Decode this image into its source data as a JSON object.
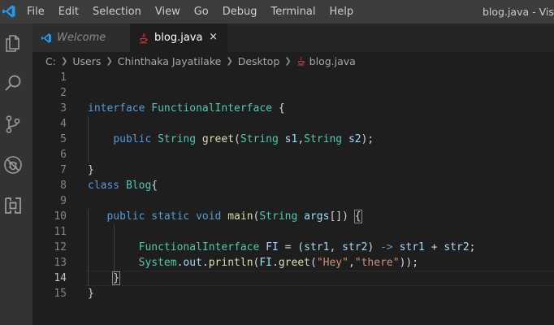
{
  "titlebar": {
    "menu": [
      "File",
      "Edit",
      "Selection",
      "View",
      "Go",
      "Debug",
      "Terminal",
      "Help"
    ],
    "window_title": "blog.java - Visua"
  },
  "activity_bar": [
    "explorer-icon",
    "search-icon",
    "source-control-icon",
    "debug-icon",
    "extensions-icon"
  ],
  "tabs": [
    {
      "label": "Welcome",
      "icon": "vscode-icon",
      "active": false
    },
    {
      "label": "blog.java",
      "icon": "java-icon",
      "active": true,
      "close": "×"
    }
  ],
  "breadcrumb": [
    "C:",
    "Users",
    "Chinthaka Jayatilake",
    "Desktop",
    "blog.java"
  ],
  "editor": {
    "current_line": 14,
    "line_numbers": [
      "1",
      "2",
      "3",
      "4",
      "5",
      "6",
      "7",
      "8",
      "9",
      "10",
      "11",
      "12",
      "13",
      "14",
      "15"
    ],
    "lines": [
      [],
      [],
      [
        {
          "t": "interface ",
          "c": "kw"
        },
        {
          "t": "FunctionalInterface",
          "c": "ty"
        },
        {
          "t": " {",
          "c": "pl"
        }
      ],
      [],
      [
        {
          "t": "    ",
          "c": "pl"
        },
        {
          "t": "public ",
          "c": "kw"
        },
        {
          "t": "String ",
          "c": "ty"
        },
        {
          "t": "greet",
          "c": "fn"
        },
        {
          "t": "(",
          "c": "pl"
        },
        {
          "t": "String ",
          "c": "ty"
        },
        {
          "t": "s1",
          "c": "vr"
        },
        {
          "t": ",",
          "c": "pl"
        },
        {
          "t": "String ",
          "c": "ty"
        },
        {
          "t": "s2",
          "c": "vr"
        },
        {
          "t": ");",
          "c": "pl"
        }
      ],
      [],
      [
        {
          "t": "}",
          "c": "pl"
        }
      ],
      [
        {
          "t": "class ",
          "c": "kw"
        },
        {
          "t": "Blog",
          "c": "ty"
        },
        {
          "t": "{",
          "c": "pl"
        }
      ],
      [],
      [
        {
          "t": "   ",
          "c": "pl"
        },
        {
          "t": "public ",
          "c": "kw"
        },
        {
          "t": "static ",
          "c": "kw"
        },
        {
          "t": "void ",
          "c": "kw"
        },
        {
          "t": "main",
          "c": "fn"
        },
        {
          "t": "(",
          "c": "pl"
        },
        {
          "t": "String ",
          "c": "ty"
        },
        {
          "t": "args",
          "c": "vr"
        },
        {
          "t": "[]) ",
          "c": "pl"
        },
        {
          "t": "{",
          "c": "pl",
          "hl": true
        }
      ],
      [],
      [
        {
          "t": "        ",
          "c": "pl"
        },
        {
          "t": "FunctionalInterface ",
          "c": "ty"
        },
        {
          "t": "FI",
          "c": "vr"
        },
        {
          "t": " = (",
          "c": "pl"
        },
        {
          "t": "str1",
          "c": "vr"
        },
        {
          "t": ", ",
          "c": "pl"
        },
        {
          "t": "str2",
          "c": "vr"
        },
        {
          "t": ") ",
          "c": "pl"
        },
        {
          "t": "->",
          "c": "kw"
        },
        {
          "t": " ",
          "c": "pl"
        },
        {
          "t": "str1",
          "c": "vr"
        },
        {
          "t": " + ",
          "c": "pl"
        },
        {
          "t": "str2",
          "c": "vr"
        },
        {
          "t": ";",
          "c": "pl"
        }
      ],
      [
        {
          "t": "        ",
          "c": "pl"
        },
        {
          "t": "System",
          "c": "ty"
        },
        {
          "t": ".",
          "c": "pl"
        },
        {
          "t": "out",
          "c": "vr"
        },
        {
          "t": ".",
          "c": "pl"
        },
        {
          "t": "println",
          "c": "fn"
        },
        {
          "t": "(",
          "c": "pl"
        },
        {
          "t": "FI",
          "c": "vr"
        },
        {
          "t": ".",
          "c": "pl"
        },
        {
          "t": "greet",
          "c": "fn"
        },
        {
          "t": "(",
          "c": "pl"
        },
        {
          "t": "\"Hey\"",
          "c": "st"
        },
        {
          "t": ",",
          "c": "pl"
        },
        {
          "t": "\"there\"",
          "c": "st"
        },
        {
          "t": "));",
          "c": "pl"
        }
      ],
      [
        {
          "t": "    ",
          "c": "pl"
        },
        {
          "t": "}",
          "c": "pl",
          "hl": true
        }
      ],
      [
        {
          "t": "}",
          "c": "pl"
        }
      ]
    ]
  }
}
